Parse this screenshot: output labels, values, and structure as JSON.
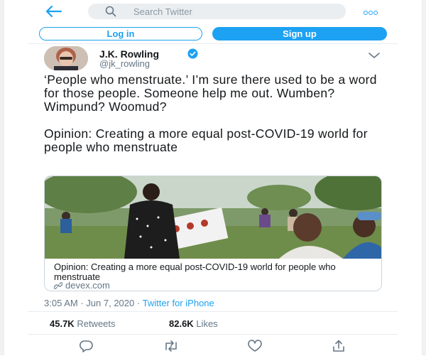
{
  "search": {
    "placeholder": "Search Twitter"
  },
  "auth": {
    "login_label": "Log in",
    "signup_label": "Sign up"
  },
  "tweet": {
    "author_name": "J.K. Rowling",
    "author_handle": "@jk_rowling",
    "text_p1": "‘People who menstruate.’ I’m sure there used to be a word for those people. Someone help me out. Wumben? Wimpund? Woomud?",
    "text_p2": "Opinion: Creating a more equal post-COVID-19 world for people who menstruate",
    "card": {
      "title": "Opinion: Creating a more equal post-COVID-19 world for people who menstruate",
      "domain": "devex.com"
    },
    "time": "3:05 AM",
    "date": "Jun 7, 2020",
    "separator": "·",
    "source": "Twitter for iPhone",
    "retweets_count": "45.7K",
    "retweets_label": "Retweets",
    "likes_count": "82.6K",
    "likes_label": "Likes"
  },
  "icons": {
    "back": "back-arrow-icon",
    "search": "search-icon",
    "more": "more-icon",
    "verified": "verified-badge-icon",
    "caret": "chevron-down-icon",
    "link": "link-icon",
    "reply": "reply-icon",
    "retweet": "retweet-icon",
    "like": "like-icon",
    "share": "share-icon"
  },
  "colors": {
    "accent": "#1da1f2",
    "text": "#14171a",
    "muted": "#657786"
  }
}
